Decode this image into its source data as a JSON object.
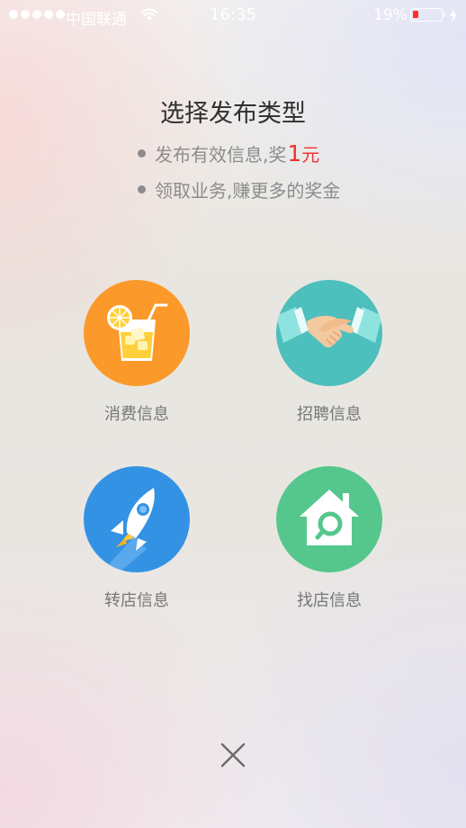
{
  "status_bar": {
    "carrier": "中国联通",
    "time": "16:35",
    "battery_percent": "19%",
    "battery_level": 0.19,
    "signal_bars": 5
  },
  "header": {
    "title": "选择发布类型",
    "bullets": [
      {
        "text": "发布有效信息,奖",
        "highlight": "1",
        "suffix": "元"
      },
      {
        "text": "领取业务,赚更多的奖金"
      }
    ]
  },
  "options": [
    {
      "label": "消费信息",
      "icon": "drink-icon",
      "color": "#fb9a2a"
    },
    {
      "label": "招聘信息",
      "icon": "handshake-icon",
      "color": "#4dbfbc"
    },
    {
      "label": "转店信息",
      "icon": "rocket-icon",
      "color": "#3492e4"
    },
    {
      "label": "找店信息",
      "icon": "house-search-icon",
      "color": "#55c78d"
    }
  ],
  "close_icon": "close-icon",
  "colors": {
    "accent_red": "#f0322f",
    "title": "#2f2f2f",
    "muted": "#8c8c8c"
  }
}
